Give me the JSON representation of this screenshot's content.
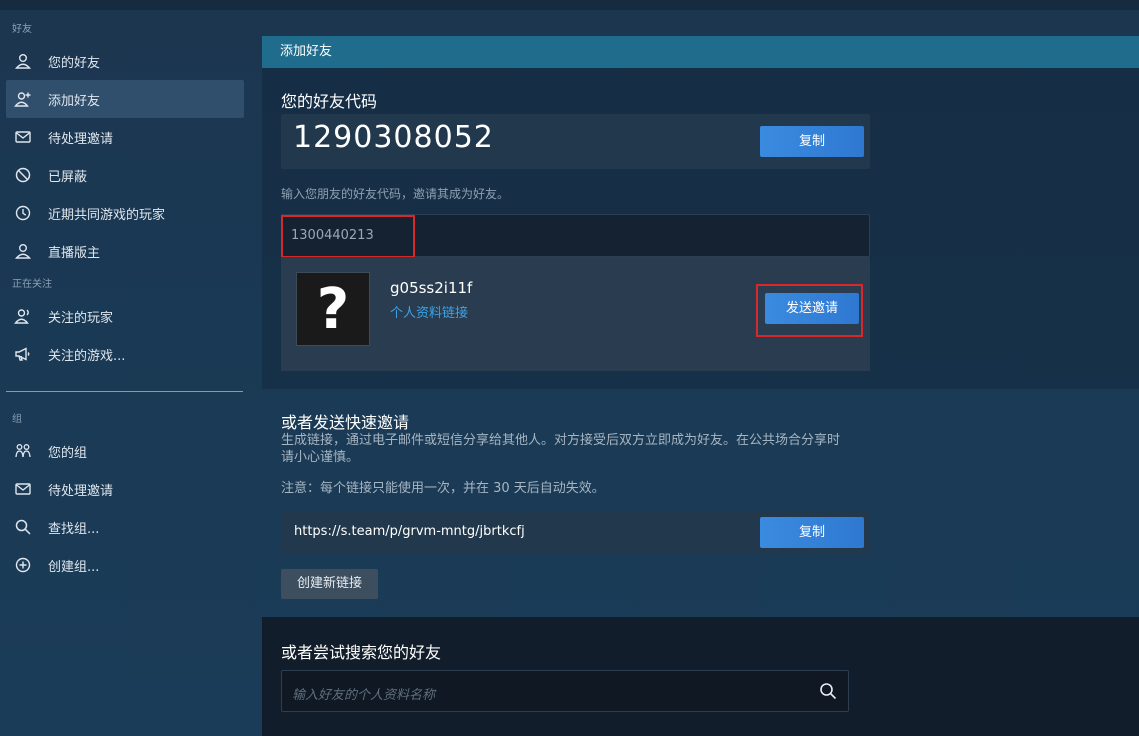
{
  "sidebar": {
    "friends_section": "好友",
    "items": [
      {
        "label": "您的好友",
        "icon": "person-icon"
      },
      {
        "label": "添加好友",
        "icon": "add-person-icon",
        "active": true
      },
      {
        "label": "待处理邀请",
        "icon": "mail-icon"
      },
      {
        "label": "已屏蔽",
        "icon": "block-icon"
      },
      {
        "label": "近期共同游戏的玩家",
        "icon": "clock-icon"
      },
      {
        "label": "直播版主",
        "icon": "person-icon"
      }
    ],
    "following_section": "正在关注",
    "following_items": [
      {
        "label": "关注的玩家",
        "icon": "follow-person-icon"
      },
      {
        "label": "关注的游戏...",
        "icon": "megaphone-icon"
      }
    ],
    "groups_section": "组",
    "group_items": [
      {
        "label": "您的组",
        "icon": "group-icon"
      },
      {
        "label": "待处理邀请",
        "icon": "mail-icon"
      },
      {
        "label": "查找组...",
        "icon": "search-icon"
      },
      {
        "label": "创建组...",
        "icon": "plus-circle-icon"
      }
    ]
  },
  "main": {
    "header": "添加好友",
    "friend_code_title": "您的好友代码",
    "friend_code": "1290308052",
    "copy_label": "复制",
    "enter_hint": "输入您朋友的好友代码，邀请其成为好友。",
    "entered_code": "1300440213",
    "result": {
      "username": "g05ss2i11f",
      "profile_link": "个人资料链接",
      "avatar_glyph": "?",
      "send_invite": "发送邀请"
    },
    "quick_invite": {
      "title": "或者发送快速邀请",
      "desc_line1": "生成链接，通过电子邮件或短信分享给其他人。对方接受后双方立即成为好友。在公共场合分享时",
      "desc_line2": "请小心谨慎。",
      "note": "注意：每个链接只能使用一次，并在 30 天后自动失效。",
      "link": "https://s.team/p/grvm-mntg/jbrtkcfj",
      "copy_label": "复制",
      "new_link": "创建新链接"
    },
    "search": {
      "title": "或者尝试搜索您的好友",
      "placeholder": "输入好友的个人资料名称"
    }
  },
  "colors": {
    "accent_blue": "#3a8be0",
    "header_teal": "#1f6c8c",
    "highlight_red": "#d8282a",
    "link_blue": "#3ba4e6"
  }
}
